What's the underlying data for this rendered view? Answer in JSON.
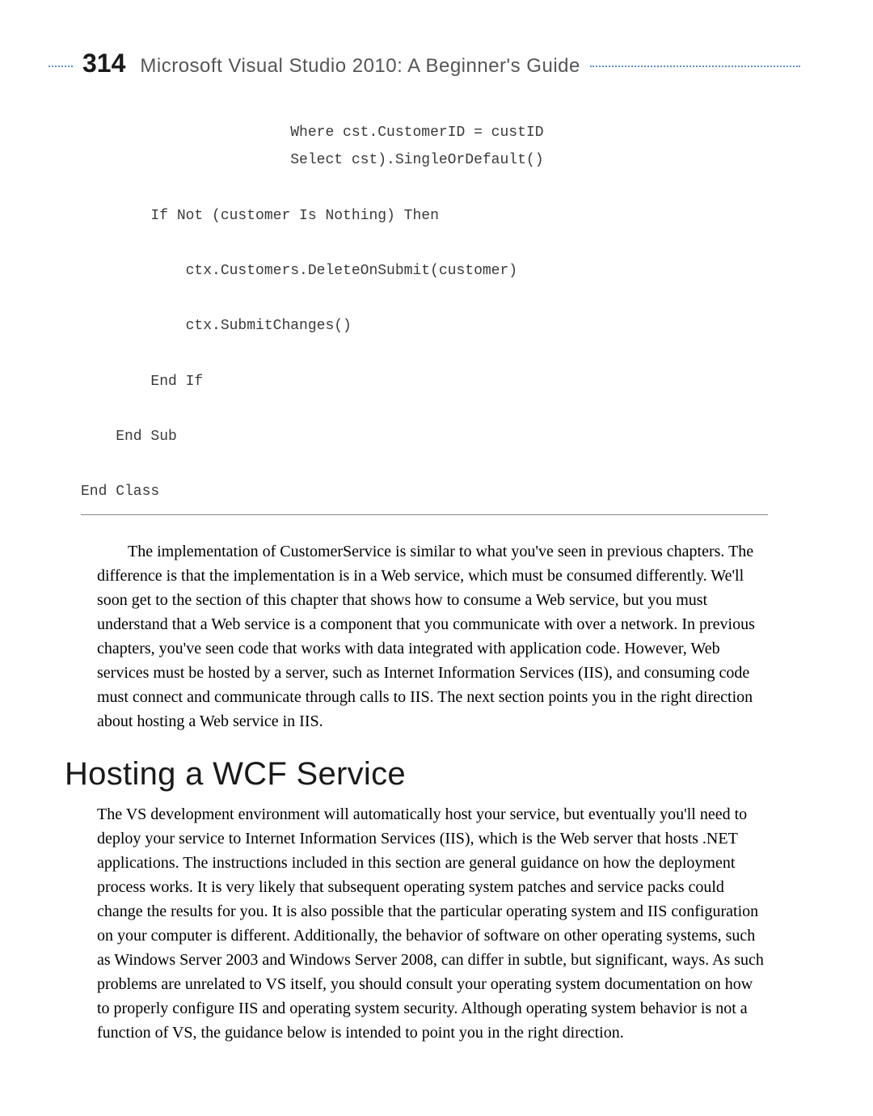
{
  "header": {
    "page_number": "314",
    "book_title": "Microsoft Visual Studio 2010: A Beginner's Guide"
  },
  "code": {
    "line1": "                        Where cst.CustomerID = custID",
    "line2": "                        Select cst).SingleOrDefault()",
    "line3": "",
    "line4": "        If Not (customer Is Nothing) Then",
    "line5": "",
    "line6": "            ctx.Customers.DeleteOnSubmit(customer)",
    "line7": "",
    "line8": "            ctx.SubmitChanges()",
    "line9": "",
    "line10": "        End If",
    "line11": "",
    "line12": "    End Sub",
    "line13": "",
    "line14": "End Class"
  },
  "paragraph1": "The implementation of CustomerService is similar to what you've seen in previous chapters. The difference is that the implementation is in a Web service, which must be consumed differently. We'll soon get to the section of this chapter that shows how to consume a Web service, but you must understand that a Web service is a component that you communicate with over a network. In previous chapters, you've seen code that works with data integrated with application code. However, Web services must be hosted by a server, such as Internet Information Services (IIS), and consuming code must connect and communicate through calls to IIS. The next section points you in the right direction about hosting a Web service in IIS.",
  "section_heading": "Hosting a WCF Service",
  "paragraph2": "The VS development environment will automatically host your service, but eventually you'll need to deploy your service to Internet Information Services (IIS), which is the Web server that hosts .NET applications. The instructions included in this section are general guidance on how the deployment process works. It is very likely that subsequent operating system patches and service packs could change the results for you. It is also possible that the particular operating system and IIS configuration on your computer is different. Additionally, the behavior of software on other operating systems, such as Windows Server 2003 and Windows Server 2008, can differ in subtle, but significant, ways. As such problems are unrelated to VS itself, you should consult your operating system documentation on how to properly configure IIS and operating system security. Although operating system behavior is not a function of VS, the guidance below is intended to point you in the right direction."
}
